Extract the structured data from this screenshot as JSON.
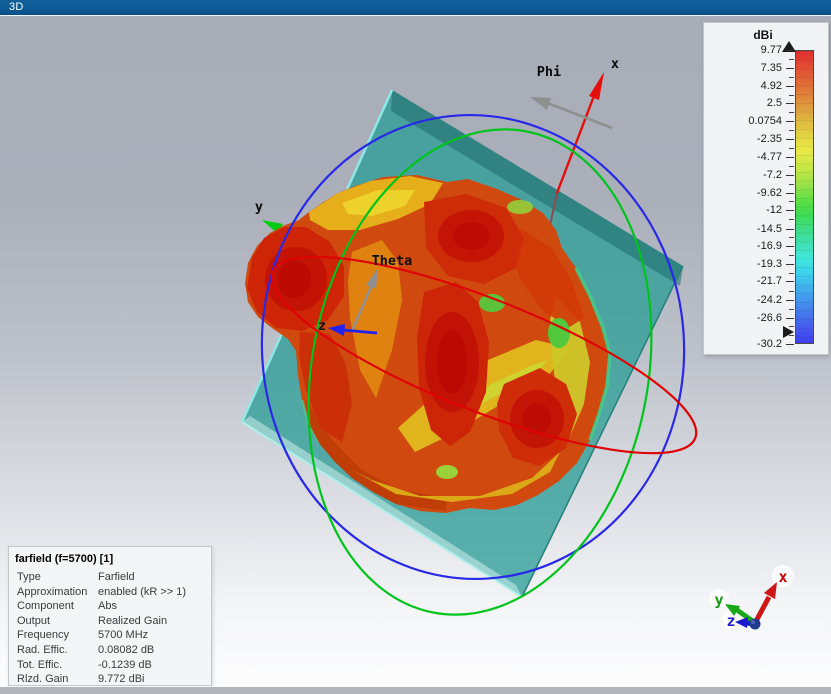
{
  "titlebar": {
    "label": "3D"
  },
  "legend": {
    "title": "dBi",
    "ticks": [
      "9.77",
      "7.35",
      "4.92",
      "2.5",
      "0.0754",
      "-2.35",
      "-4.77",
      "-7.2",
      "-9.62",
      "-12",
      "-14.5",
      "-16.9",
      "-19.3",
      "-21.7",
      "-24.2",
      "-26.6",
      "-30.2"
    ]
  },
  "scene": {
    "axis_labels": {
      "x": "x",
      "y": "y",
      "z": "z",
      "phi": "Phi",
      "theta": "Theta"
    },
    "triad_labels": {
      "x": "x",
      "y": "y",
      "z": "z"
    }
  },
  "info_panel": {
    "title": "farfield (f=5700) [1]",
    "rows": [
      {
        "label": "Type",
        "value": "Farfield"
      },
      {
        "label": "Approximation",
        "value": "enabled (kR >> 1)"
      },
      {
        "label": "Component",
        "value": "Abs"
      },
      {
        "label": "Output",
        "value": "Realized Gain"
      },
      {
        "label": "Frequency",
        "value": "5700 MHz"
      },
      {
        "label": "Rad. Effic.",
        "value": "0.08082 dB"
      },
      {
        "label": "Tot. Effic.",
        "value": "-0.1239 dB"
      },
      {
        "label": "Rlzd. Gain",
        "value": "9.772 dBi"
      }
    ]
  },
  "colors": {
    "titlebar": "#0d5791",
    "plate_teal": "#2e9e97",
    "axis_x_red": "#e60d0d",
    "axis_y_green": "#00cc11",
    "axis_z_blue": "#2222ee",
    "circle_red": "#de0404",
    "circle_green": "#00c41c",
    "circle_blue": "#2828e8",
    "gain_max_red": "#c41406",
    "legend_top_value": "9.77",
    "legend_bottom_value": "-30.2"
  }
}
